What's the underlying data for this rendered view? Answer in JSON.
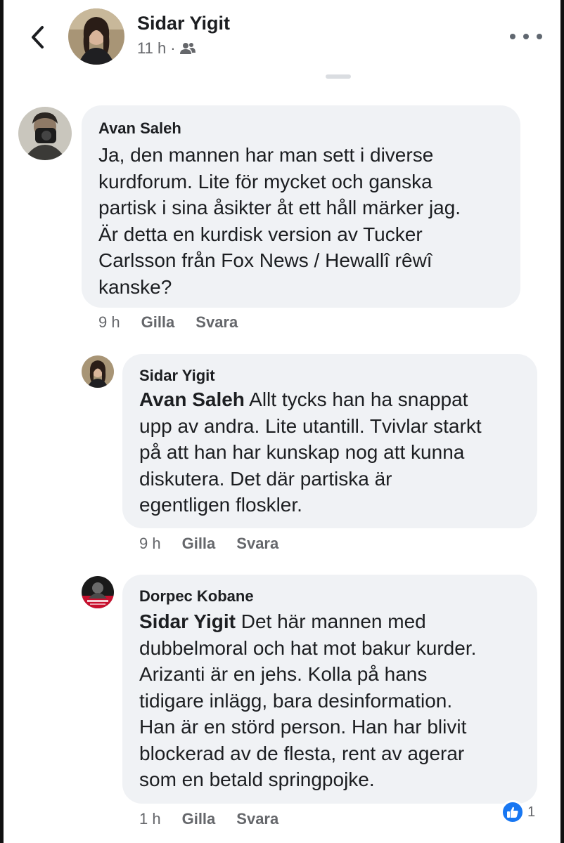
{
  "colors": {
    "bubble_bg": "#f0f2f5",
    "meta_text": "#65676b",
    "like_blue": "#1877f2"
  },
  "header": {
    "name": "Sidar Yigit",
    "time": "11 h",
    "audience_icon": "friends-icon",
    "back_icon": "chevron-left-icon",
    "more_icon": "more-horizontal-icon"
  },
  "comments": [
    {
      "author": "Avan Saleh",
      "mention": "",
      "lines": [
        "Ja, den mannen har man sett i diverse",
        "kurdforum. Lite för mycket och ganska",
        "partisk i sina åsikter åt ett håll märker jag.",
        "Är detta en kurdisk version av Tucker",
        "Carlsson från Fox News / Hewallî rêwî",
        "kanske?"
      ],
      "time": "9 h",
      "like_label": "Gilla",
      "reply_label": "Svara"
    },
    {
      "author": "Sidar Yigit",
      "mention": "Avan Saleh",
      "first_line_rest": " Allt tycks han ha snappat",
      "lines": [
        "upp av andra. Lite utantill. Tvivlar starkt",
        "på att han har kunskap nog att kunna",
        "diskutera. Det där partiska är",
        "egentligen floskler."
      ],
      "time": "9 h",
      "like_label": "Gilla",
      "reply_label": "Svara"
    },
    {
      "author": "Dorpec Kobane",
      "mention": "Sidar Yigit",
      "first_line_rest": " Det här mannen med",
      "lines": [
        "dubbelmoral och hat mot bakur kurder.",
        "Arizanti är en jehs. Kolla på hans",
        "tidigare inlägg, bara desinformation.",
        "Han är en störd person. Han har blivit",
        "blockerad av de flesta, rent av agerar",
        "som en betald springpojke."
      ],
      "time": "1 h",
      "like_label": "Gilla",
      "reply_label": "Svara",
      "reactions": {
        "icon": "like-icon",
        "count": "1"
      }
    }
  ]
}
